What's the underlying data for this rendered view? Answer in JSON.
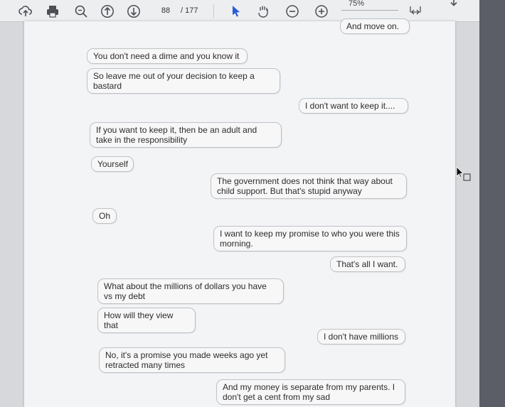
{
  "toolbar": {
    "page_current": "88",
    "page_total": "/ 177",
    "zoom": "75%",
    "icons": [
      "share-icon",
      "print-icon",
      "zoom-out-icon",
      "prev-page-icon",
      "next-page-icon",
      "select-cursor-icon",
      "pan-hand-icon",
      "zoom-minus-icon",
      "zoom-plus-icon",
      "fit-page-icon",
      "download-icon"
    ]
  },
  "messages": [
    {
      "side": "right",
      "text": "And move on."
    },
    {
      "side": "left",
      "text": "You don't need a dime and you know it"
    },
    {
      "side": "left",
      "text": "So leave me out of your decision to keep a bastard"
    },
    {
      "side": "right",
      "text": "I don't want to keep it...."
    },
    {
      "side": "left",
      "text": "If you want to keep it, then be an adult and take in the responsibility"
    },
    {
      "side": "left",
      "text": "Yourself"
    },
    {
      "side": "right",
      "text": "The government does not think that way about child support. But that's stupid anyway"
    },
    {
      "side": "left",
      "text": "Oh"
    },
    {
      "side": "right",
      "text": "I want to keep my promise to who you were this morning."
    },
    {
      "side": "right",
      "text": "That's all I want."
    },
    {
      "side": "left",
      "text": "What about the millions of dollars you have vs my debt"
    },
    {
      "side": "left",
      "text": "How will they view that"
    },
    {
      "side": "right",
      "text": "I don't have millions"
    },
    {
      "side": "left",
      "text": "No, it's a promise you made weeks ago yet retracted many times"
    },
    {
      "side": "right",
      "text": "And my money is separate from my parents. I don't get a cent from my sad"
    }
  ]
}
